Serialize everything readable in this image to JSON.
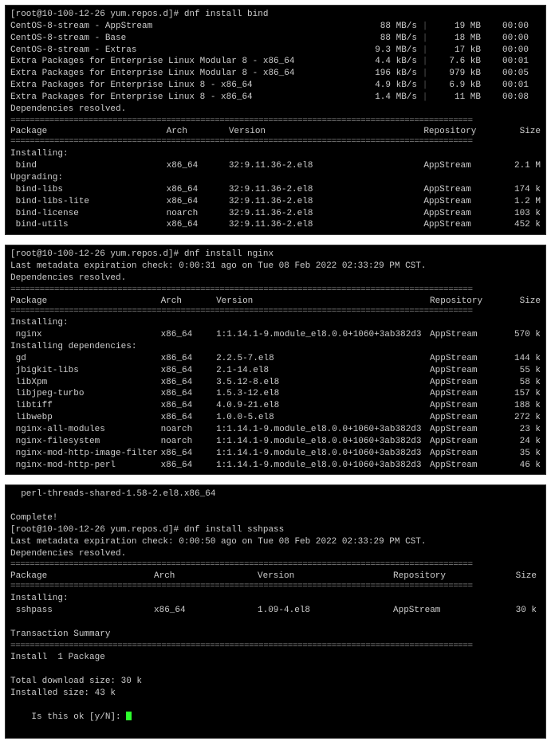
{
  "panel1": {
    "prompt": "[root@10-100-12-26 yum.repos.d]# dnf install bind",
    "downloads": [
      {
        "name": "CentOS-8-stream - AppStream",
        "speed": "88 MB/s",
        "size": "19 MB",
        "time": "00:00"
      },
      {
        "name": "CentOS-8-stream - Base",
        "speed": "88 MB/s",
        "size": "18 MB",
        "time": "00:00"
      },
      {
        "name": "CentOS-8-stream - Extras",
        "speed": "9.3 MB/s",
        "size": "17 kB",
        "time": "00:00"
      },
      {
        "name": "Extra Packages for Enterprise Linux Modular 8 - x86_64",
        "speed": "4.4 kB/s",
        "size": "7.6 kB",
        "time": "00:01"
      },
      {
        "name": "Extra Packages for Enterprise Linux Modular 8 - x86_64",
        "speed": "196 kB/s",
        "size": "979 kB",
        "time": "00:05"
      },
      {
        "name": "Extra Packages for Enterprise Linux 8 - x86_64",
        "speed": "4.9 kB/s",
        "size": "6.9 kB",
        "time": "00:01"
      },
      {
        "name": "Extra Packages for Enterprise Linux 8 - x86_64",
        "speed": "1.4 MB/s",
        "size": "11 MB",
        "time": "00:08"
      }
    ],
    "resolved": "Dependencies resolved.",
    "headers": {
      "pkg": "Package",
      "arch": "Arch",
      "ver": "Version",
      "repo": "Repository",
      "size": "Size"
    },
    "installing_label": "Installing:",
    "upgrading_label": "Upgrading:",
    "install_rows": [
      {
        "pkg": " bind",
        "arch": "x86_64",
        "ver": "32:9.11.36-2.el8",
        "repo": "AppStream",
        "size": "2.1 M"
      }
    ],
    "upgrade_rows": [
      {
        "pkg": " bind-libs",
        "arch": "x86_64",
        "ver": "32:9.11.36-2.el8",
        "repo": "AppStream",
        "size": "174 k"
      },
      {
        "pkg": " bind-libs-lite",
        "arch": "x86_64",
        "ver": "32:9.11.36-2.el8",
        "repo": "AppStream",
        "size": "1.2 M"
      },
      {
        "pkg": " bind-license",
        "arch": "noarch",
        "ver": "32:9.11.36-2.el8",
        "repo": "AppStream",
        "size": "103 k"
      },
      {
        "pkg": " bind-utils",
        "arch": "x86_64",
        "ver": "32:9.11.36-2.el8",
        "repo": "AppStream",
        "size": "452 k"
      }
    ]
  },
  "panel2": {
    "prompt": "[root@10-100-12-26 yum.repos.d]# dnf install nginx",
    "meta": "Last metadata expiration check: 0:00:31 ago on Tue 08 Feb 2022 02:33:29 PM CST.",
    "resolved": "Dependencies resolved.",
    "headers": {
      "pkg": "Package",
      "arch": "Arch",
      "ver": "Version",
      "repo": "Repository",
      "size": "Size"
    },
    "installing_label": "Installing:",
    "deps_label": "Installing dependencies:",
    "install_rows": [
      {
        "pkg": " nginx",
        "arch": "x86_64",
        "ver": "1:1.14.1-9.module_el8.0.0+1060+3ab382d3",
        "repo": "AppStream",
        "size": "570 k"
      }
    ],
    "dep_rows": [
      {
        "pkg": " gd",
        "arch": "x86_64",
        "ver": "2.2.5-7.el8",
        "repo": "AppStream",
        "size": "144 k"
      },
      {
        "pkg": " jbigkit-libs",
        "arch": "x86_64",
        "ver": "2.1-14.el8",
        "repo": "AppStream",
        "size": "55 k"
      },
      {
        "pkg": " libXpm",
        "arch": "x86_64",
        "ver": "3.5.12-8.el8",
        "repo": "AppStream",
        "size": "58 k"
      },
      {
        "pkg": " libjpeg-turbo",
        "arch": "x86_64",
        "ver": "1.5.3-12.el8",
        "repo": "AppStream",
        "size": "157 k"
      },
      {
        "pkg": " libtiff",
        "arch": "x86_64",
        "ver": "4.0.9-21.el8",
        "repo": "AppStream",
        "size": "188 k"
      },
      {
        "pkg": " libwebp",
        "arch": "x86_64",
        "ver": "1.0.0-5.el8",
        "repo": "AppStream",
        "size": "272 k"
      },
      {
        "pkg": " nginx-all-modules",
        "arch": "noarch",
        "ver": "1:1.14.1-9.module_el8.0.0+1060+3ab382d3",
        "repo": "AppStream",
        "size": "23 k"
      },
      {
        "pkg": " nginx-filesystem",
        "arch": "noarch",
        "ver": "1:1.14.1-9.module_el8.0.0+1060+3ab382d3",
        "repo": "AppStream",
        "size": "24 k"
      },
      {
        "pkg": " nginx-mod-http-image-filter",
        "arch": "x86_64",
        "ver": "1:1.14.1-9.module_el8.0.0+1060+3ab382d3",
        "repo": "AppStream",
        "size": "35 k"
      },
      {
        "pkg": " nginx-mod-http-perl",
        "arch": "x86_64",
        "ver": "1:1.14.1-9.module_el8.0.0+1060+3ab382d3",
        "repo": "AppStream",
        "size": "46 k"
      }
    ]
  },
  "panel3": {
    "top_line": "  perl-threads-shared-1.58-2.el8.x86_64",
    "complete": "Complete!",
    "prompt": "[root@10-100-12-26 yum.repos.d]# dnf install sshpass",
    "meta": "Last metadata expiration check: 0:00:50 ago on Tue 08 Feb 2022 02:33:29 PM CST.",
    "resolved": "Dependencies resolved.",
    "headers": {
      "pkg": "Package",
      "arch": "Arch",
      "ver": "Version",
      "repo": "Repository",
      "size": "Size"
    },
    "installing_label": "Installing:",
    "install_rows": [
      {
        "pkg": " sshpass",
        "arch": "x86_64",
        "ver": "1.09-4.el8",
        "repo": "AppStream",
        "size": "30 k"
      }
    ],
    "tx_summary": "Transaction Summary",
    "install_count": "Install  1 Package",
    "total_dl": "Total download size: 30 k",
    "installed_size": "Installed size: 43 k",
    "confirm": "Is this ok [y/N]: "
  },
  "sep_double": "===============================================================================================",
  "sep_single": "-----------------------------------------------------------------------------------------------"
}
